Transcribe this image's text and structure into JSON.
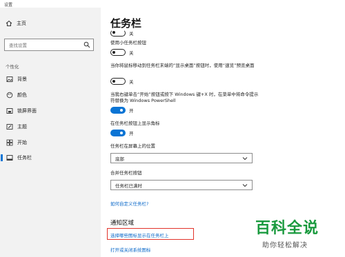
{
  "window": {
    "title": "设置"
  },
  "sidebar": {
    "home_label": "主页",
    "search_placeholder": "查找设置",
    "section_label": "个性化",
    "items": [
      {
        "label": "背景",
        "icon": "image-icon"
      },
      {
        "label": "颜色",
        "icon": "palette-icon"
      },
      {
        "label": "锁屏界面",
        "icon": "lockscreen-icon"
      },
      {
        "label": "主题",
        "icon": "brush-icon"
      },
      {
        "label": "开始",
        "icon": "start-grid-icon"
      },
      {
        "label": "任务栏",
        "icon": "taskbar-icon",
        "active": true
      }
    ]
  },
  "main": {
    "title": "任务栏",
    "top_partial_toggle_text": "关",
    "setting1_label": "使用小任务栏按钮",
    "setting1_state": "关",
    "setting2_label": "当你将鼠标移动到任务栏末端的“显示桌面”按钮时，使用“速览”预览桌面",
    "setting2_state": "关",
    "setting3_label": "当我右键单击“开始”按钮或按下 Windows 键+X 时，在菜单中将命令提示符替换为 Windows PowerShell",
    "setting3_state": "开",
    "setting4_label": "在任务栏按钮上显示角标",
    "setting4_state": "开",
    "position_label": "任务栏在屏幕上的位置",
    "position_value": "底部",
    "combine_label": "合并任务栏按钮",
    "combine_value": "任务栏已满时",
    "customize_link": "如何自定义任务栏?",
    "notify_section": "通知区域",
    "notify_link1": "选择哪些图标显示在任务栏上",
    "notify_link2": "打开或关闭系统图标"
  },
  "watermark": {
    "main": "百科全说",
    "sub": "助你轻松解决"
  },
  "colors": {
    "accent": "#0a74d4",
    "highlight": "#e2332a",
    "watermark": "#1a9a3e"
  }
}
